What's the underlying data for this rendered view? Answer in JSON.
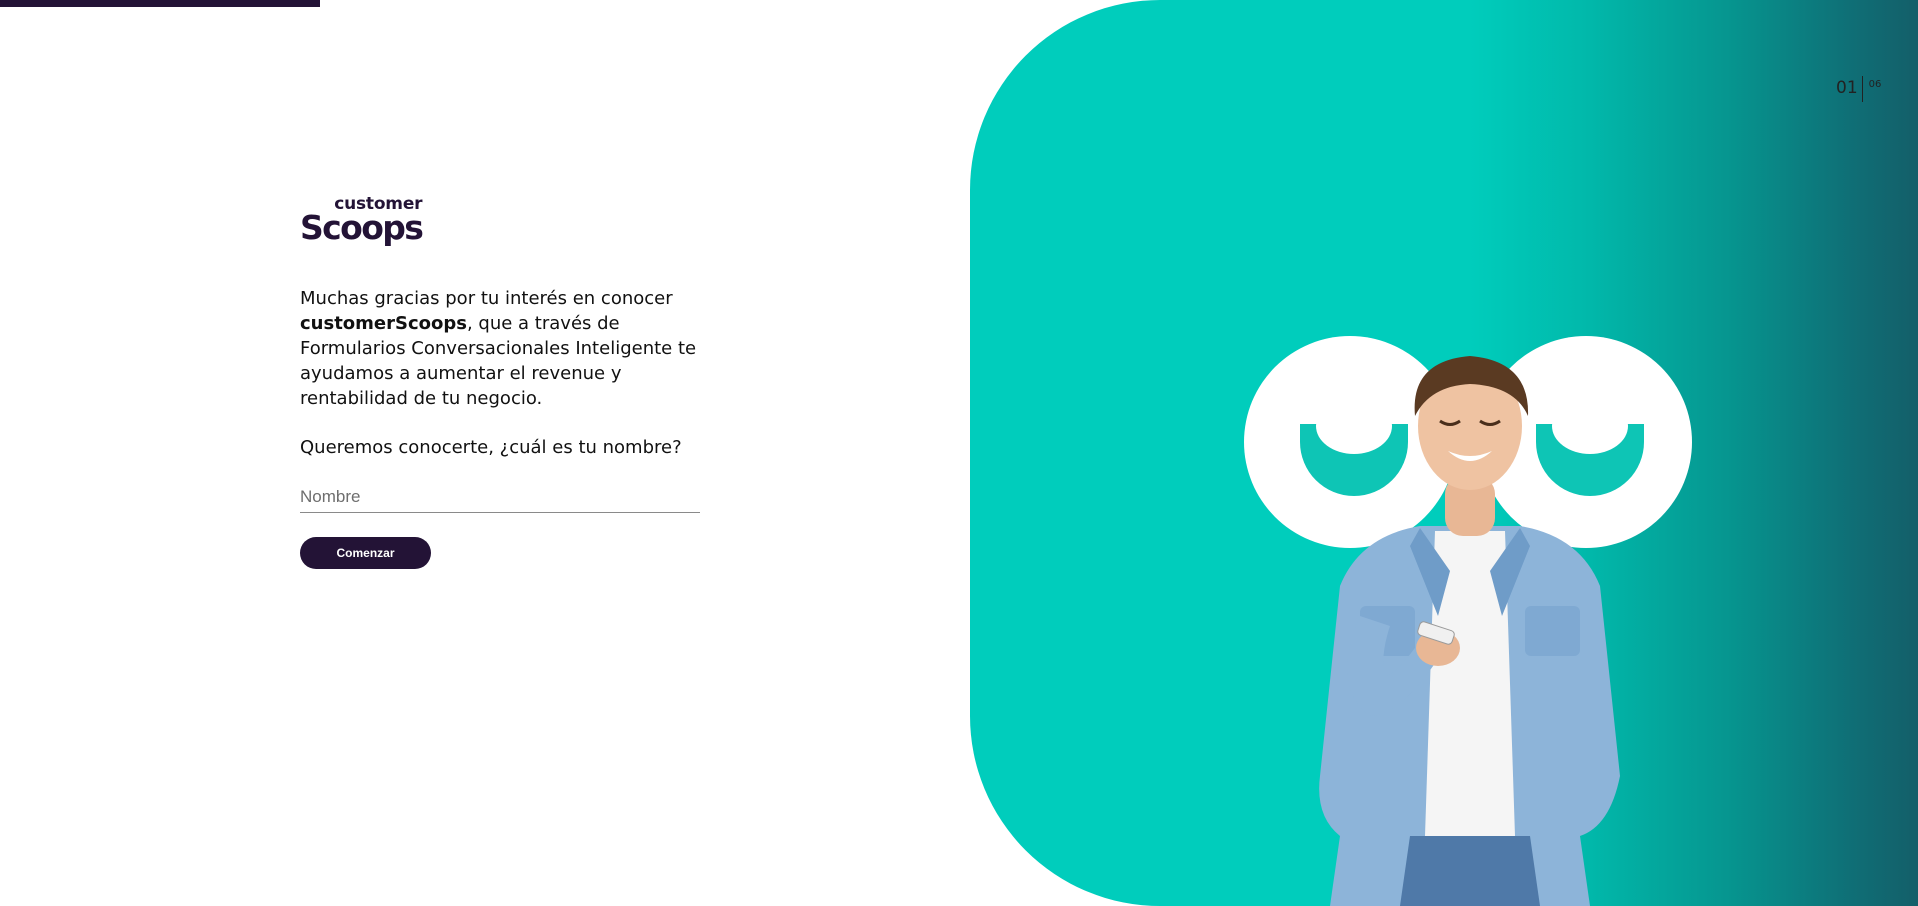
{
  "progress": {
    "fraction": 0.167,
    "color": "#231336"
  },
  "logo": {
    "top": "customer",
    "bottom": "Scoops"
  },
  "intro": {
    "before": "Muchas gracias por tu interés en conocer ",
    "brand": "customerScoops",
    "after": ", que a través de Formularios Conversacionales Inteligente te ayudamos a aumentar el revenue y rentabilidad de tu negocio."
  },
  "question": "Queremos conocerte, ¿cuál es tu nombre?",
  "name_field": {
    "placeholder": "Nombre",
    "value": ""
  },
  "start_button": {
    "label": "Comenzar"
  },
  "pagination": {
    "current": "01",
    "total": "06"
  },
  "colors": {
    "brand_dark": "#231336",
    "teal": "#00cdbc",
    "teal_dark": "#17525f"
  },
  "hero_image": {
    "subject": "smiling man in denim shirt looking at smartphone"
  }
}
